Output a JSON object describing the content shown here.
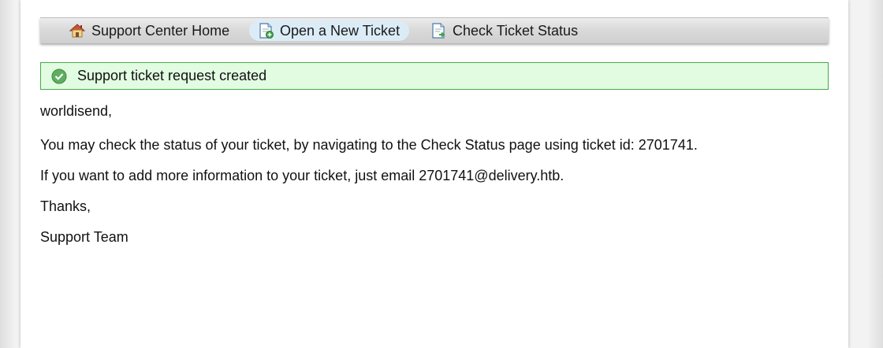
{
  "nav": {
    "items": [
      {
        "label": "Support Center Home",
        "icon": "house-icon",
        "active": false
      },
      {
        "label": "Open a New Ticket",
        "icon": "new-ticket-icon",
        "active": true
      },
      {
        "label": "Check Ticket Status",
        "icon": "ticket-status-icon",
        "active": false
      }
    ]
  },
  "notice": {
    "text": "Support ticket request created",
    "icon": "check-circle-icon",
    "color": "#e2fce2"
  },
  "message": {
    "greeting": "worldisend,",
    "line1": "You may check the status of your ticket, by navigating to the Check Status page using ticket id: 2701741.",
    "line2": "If you want to add more information to your ticket, just email 2701741@delivery.htb.",
    "thanks": "Thanks,",
    "signature": "Support Team"
  }
}
